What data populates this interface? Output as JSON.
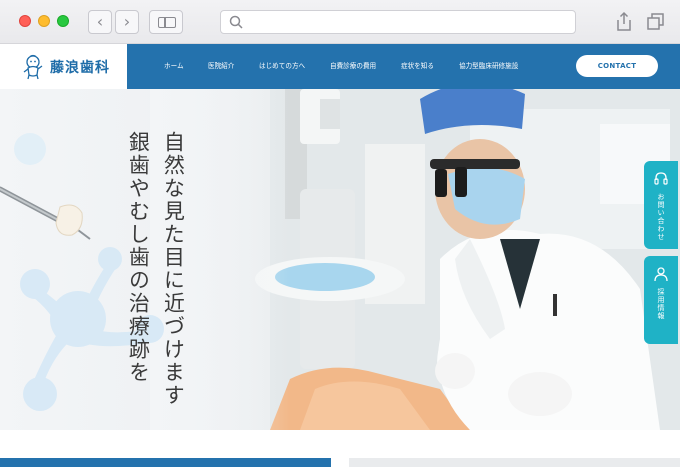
{
  "browser": {
    "back_icon": "chevron-left-icon",
    "forward_icon": "chevron-right-icon",
    "sidebar_icon": "sidebar-icon",
    "search_icon": "search-icon",
    "share_icon": "share-icon",
    "tabs_icon": "tabs-icon",
    "back_glyph": "‹",
    "forward_glyph": "›"
  },
  "site": {
    "logo_text": "藤浪歯科",
    "nav": [
      "ホーム",
      "医院紹介",
      "はじめての方へ",
      "自費診療の費用",
      "症状を知る",
      "協力型臨床研修施設"
    ],
    "contact_label": "CONTACT",
    "brand_color": "#2472ad",
    "accent_color": "#1fb2c6"
  },
  "hero": {
    "line1": "自然な見た目に近づけます",
    "line2": "銀歯やむし歯の治療跡を"
  },
  "side_tabs": [
    {
      "label": "お問い合わせ",
      "icon": "headset-icon"
    },
    {
      "label": "採用情報",
      "icon": "person-icon"
    }
  ]
}
